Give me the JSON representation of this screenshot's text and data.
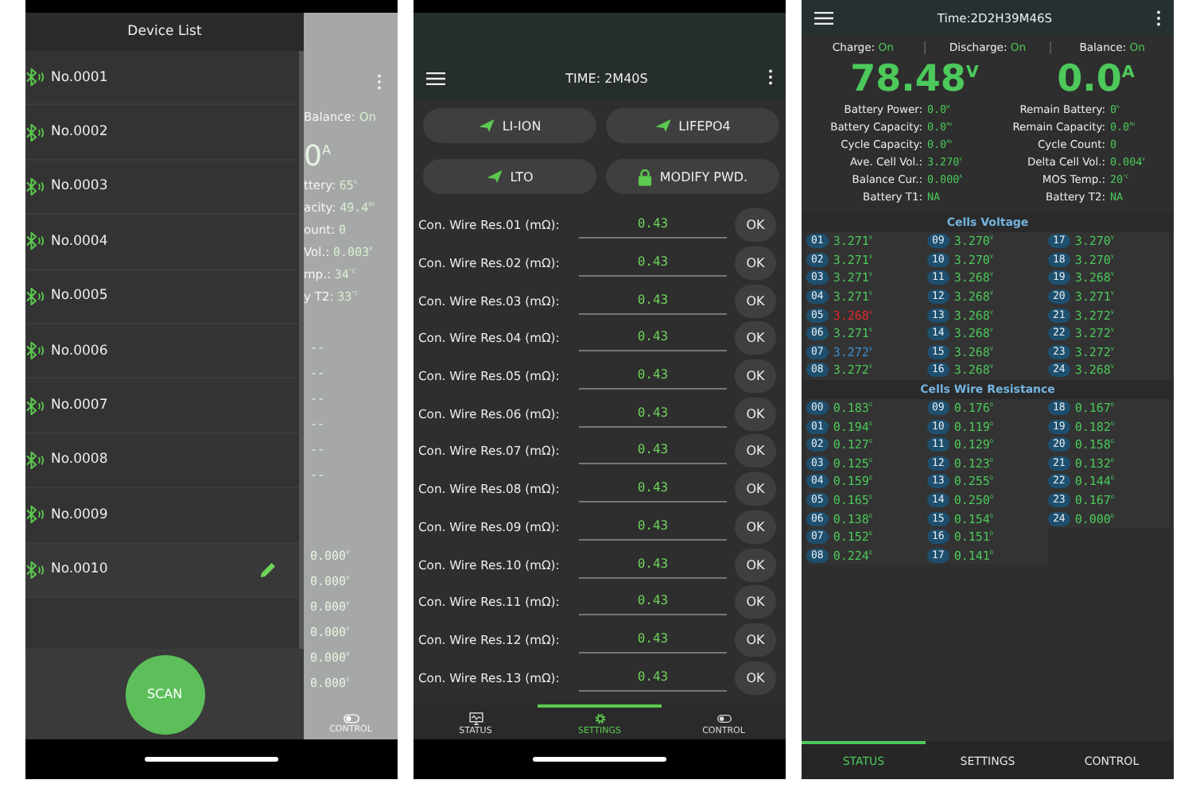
{
  "device_list_screen": {
    "title": "Device List",
    "devices": [
      {
        "name": "No.0001",
        "selected": false
      },
      {
        "name": "No.0002",
        "selected": false
      },
      {
        "name": "No.0003",
        "selected": false
      },
      {
        "name": "No.0004",
        "selected": false
      },
      {
        "name": "No.0005",
        "selected": false
      },
      {
        "name": "No.0006",
        "selected": false
      },
      {
        "name": "No.0007",
        "selected": false
      },
      {
        "name": "No.0008",
        "selected": false
      },
      {
        "name": "No.0009",
        "selected": false
      },
      {
        "name": "No.0010",
        "selected": true
      }
    ],
    "scan_button": "SCAN",
    "background_screen": {
      "balance_label": "Balance:",
      "balance_value": "On",
      "current": "0",
      "current_unit": "A",
      "stats": [
        {
          "label": "ttery:",
          "value": "65",
          "unit": "%"
        },
        {
          "label": "acity:",
          "value": "49.4",
          "unit": "Ah"
        },
        {
          "label": "ount:",
          "value": "0"
        },
        {
          "label": "Vol.:",
          "value": "0.003",
          "unit": "V"
        },
        {
          "label": "mp.:",
          "value": "34",
          "unit": "°C"
        },
        {
          "label": "y T2:",
          "value": "33",
          "unit": "°C"
        }
      ],
      "values": [
        {
          "value": "--"
        },
        {
          "value": "--"
        },
        {
          "value": "--"
        },
        {
          "value": "--"
        },
        {
          "value": "--"
        },
        {
          "value": "--"
        },
        {
          "value": "0.000",
          "unit": "V"
        },
        {
          "value": "0.000",
          "unit": "V"
        },
        {
          "value": "0.000",
          "unit": "V"
        },
        {
          "value": "0.000",
          "unit": "V"
        },
        {
          "value": "0.000",
          "unit": "V"
        },
        {
          "value": "0.000",
          "unit": "V"
        }
      ],
      "tab": {
        "label": "CONTROL"
      }
    }
  },
  "settings_screen": {
    "title": "TIME: 2M40S",
    "presets": [
      {
        "label": "LI-ION",
        "kind": "preset"
      },
      {
        "label": "LIFEPO4",
        "kind": "preset"
      },
      {
        "label": "LTO",
        "kind": "preset"
      },
      {
        "label": "MODIFY PWD.",
        "kind": "password"
      }
    ],
    "rows": [
      {
        "label": "Con. Wire Res.01 (mΩ):",
        "value": "0.43",
        "button": "OK"
      },
      {
        "label": "Con. Wire Res.02 (mΩ):",
        "value": "0.43",
        "button": "OK"
      },
      {
        "label": "Con. Wire Res.03 (mΩ):",
        "value": "0.43",
        "button": "OK"
      },
      {
        "label": "Con. Wire Res.04 (mΩ):",
        "value": "0.43",
        "button": "OK"
      },
      {
        "label": "Con. Wire Res.05 (mΩ):",
        "value": "0.43",
        "button": "OK"
      },
      {
        "label": "Con. Wire Res.06 (mΩ):",
        "value": "0.43",
        "button": "OK"
      },
      {
        "label": "Con. Wire Res.07 (mΩ):",
        "value": "0.43",
        "button": "OK"
      },
      {
        "label": "Con. Wire Res.08 (mΩ):",
        "value": "0.43",
        "button": "OK"
      },
      {
        "label": "Con. Wire Res.09 (mΩ):",
        "value": "0.43",
        "button": "OK"
      },
      {
        "label": "Con. Wire Res.10 (mΩ):",
        "value": "0.43",
        "button": "OK"
      },
      {
        "label": "Con. Wire Res.11 (mΩ):",
        "value": "0.43",
        "button": "OK"
      },
      {
        "label": "Con. Wire Res.12 (mΩ):",
        "value": "0.43",
        "button": "OK"
      },
      {
        "label": "Con. Wire Res.13 (mΩ):",
        "value": "0.43",
        "button": "OK"
      }
    ],
    "nav": [
      {
        "label": "STATUS",
        "selected": false
      },
      {
        "label": "SETTINGS",
        "selected": true
      },
      {
        "label": "CONTROL",
        "selected": false
      }
    ]
  },
  "status_screen": {
    "title": "Time:2D2H39M46S",
    "switches": [
      {
        "label": "Charge:",
        "value": "On"
      },
      {
        "label": "Discharge:",
        "value": "On"
      },
      {
        "label": "Balance:",
        "value": "On"
      }
    ],
    "voltage": {
      "value": "78.48",
      "unit": "V"
    },
    "current": {
      "value": "0.0",
      "unit": "A"
    },
    "stats_left": [
      {
        "label": "Battery Power:",
        "value": "0.0",
        "unit": "W"
      },
      {
        "label": "Battery Capacity:",
        "value": "0.0",
        "unit": "Ah"
      },
      {
        "label": "Cycle Capacity:",
        "value": "0.0",
        "unit": "Ah"
      },
      {
        "label": "Ave. Cell Vol.:",
        "value": "3.270",
        "unit": "V"
      },
      {
        "label": "Balance Cur.:",
        "value": "0.000",
        "unit": "A"
      },
      {
        "label": "Battery T1:",
        "value": "NA"
      }
    ],
    "stats_right": [
      {
        "label": "Remain Battery:",
        "value": "0",
        "unit": "%"
      },
      {
        "label": "Remain Capacity:",
        "value": "0.0",
        "unit": "Ah"
      },
      {
        "label": "Cycle Count:",
        "value": "0"
      },
      {
        "label": "Delta Cell Vol.:",
        "value": "0.004",
        "unit": "V"
      },
      {
        "label": "MOS Temp.:",
        "value": "20",
        "unit": "°C"
      },
      {
        "label": "Battery T2:",
        "value": "NA"
      }
    ],
    "cells_voltage": {
      "title": "Cells Voltage",
      "cells": [
        {
          "index": "01",
          "value": "3.271",
          "unit": "V",
          "color": "#4cc95a"
        },
        {
          "index": "02",
          "value": "3.271",
          "unit": "V",
          "color": "#4cc95a"
        },
        {
          "index": "03",
          "value": "3.271",
          "unit": "V",
          "color": "#4cc95a"
        },
        {
          "index": "04",
          "value": "3.271",
          "unit": "V",
          "color": "#4cc95a"
        },
        {
          "index": "05",
          "value": "3.268",
          "unit": "V",
          "color": "#e02828"
        },
        {
          "index": "06",
          "value": "3.271",
          "unit": "V",
          "color": "#4cc95a"
        },
        {
          "index": "07",
          "value": "3.272",
          "unit": "V",
          "color": "#3b8fd6"
        },
        {
          "index": "08",
          "value": "3.272",
          "unit": "V",
          "color": "#4cc95a"
        },
        {
          "index": "09",
          "value": "3.270",
          "unit": "V",
          "color": "#4cc95a"
        },
        {
          "index": "10",
          "value": "3.270",
          "unit": "V",
          "color": "#4cc95a"
        },
        {
          "index": "11",
          "value": "3.268",
          "unit": "V",
          "color": "#4cc95a"
        },
        {
          "index": "12",
          "value": "3.268",
          "unit": "V",
          "color": "#4cc95a"
        },
        {
          "index": "13",
          "value": "3.268",
          "unit": "V",
          "color": "#4cc95a"
        },
        {
          "index": "14",
          "value": "3.268",
          "unit": "V",
          "color": "#4cc95a"
        },
        {
          "index": "15",
          "value": "3.268",
          "unit": "V",
          "color": "#4cc95a"
        },
        {
          "index": "16",
          "value": "3.268",
          "unit": "V",
          "color": "#4cc95a"
        },
        {
          "index": "17",
          "value": "3.270",
          "unit": "V",
          "color": "#4cc95a"
        },
        {
          "index": "18",
          "value": "3.270",
          "unit": "V",
          "color": "#4cc95a"
        },
        {
          "index": "19",
          "value": "3.268",
          "unit": "V",
          "color": "#4cc95a"
        },
        {
          "index": "20",
          "value": "3.271",
          "unit": "V",
          "color": "#4cc95a"
        },
        {
          "index": "21",
          "value": "3.272",
          "unit": "V",
          "color": "#4cc95a"
        },
        {
          "index": "22",
          "value": "3.272",
          "unit": "V",
          "color": "#4cc95a"
        },
        {
          "index": "23",
          "value": "3.272",
          "unit": "V",
          "color": "#4cc95a"
        },
        {
          "index": "24",
          "value": "3.268",
          "unit": "V",
          "color": "#4cc95a"
        }
      ]
    },
    "cells_wire_resistance": {
      "title": "Cells Wire Resistance",
      "cells": [
        {
          "index": "00",
          "value": "0.183",
          "unit": "Ω"
        },
        {
          "index": "01",
          "value": "0.194",
          "unit": "Ω"
        },
        {
          "index": "02",
          "value": "0.127",
          "unit": "Ω"
        },
        {
          "index": "03",
          "value": "0.125",
          "unit": "Ω"
        },
        {
          "index": "04",
          "value": "0.159",
          "unit": "Ω"
        },
        {
          "index": "05",
          "value": "0.165",
          "unit": "Ω"
        },
        {
          "index": "06",
          "value": "0.138",
          "unit": "Ω"
        },
        {
          "index": "07",
          "value": "0.152",
          "unit": "Ω"
        },
        {
          "index": "08",
          "value": "0.224",
          "unit": "Ω"
        },
        {
          "index": "09",
          "value": "0.176",
          "unit": "Ω"
        },
        {
          "index": "10",
          "value": "0.119",
          "unit": "Ω"
        },
        {
          "index": "11",
          "value": "0.129",
          "unit": "Ω"
        },
        {
          "index": "12",
          "value": "0.123",
          "unit": "Ω"
        },
        {
          "index": "13",
          "value": "0.255",
          "unit": "Ω"
        },
        {
          "index": "14",
          "value": "0.250",
          "unit": "Ω"
        },
        {
          "index": "15",
          "value": "0.154",
          "unit": "Ω"
        },
        {
          "index": "16",
          "value": "0.151",
          "unit": "Ω"
        },
        {
          "index": "17",
          "value": "0.141",
          "unit": "Ω"
        },
        {
          "index": "18",
          "value": "0.167",
          "unit": "Ω"
        },
        {
          "index": "19",
          "value": "0.182",
          "unit": "Ω"
        },
        {
          "index": "20",
          "value": "0.158",
          "unit": "Ω"
        },
        {
          "index": "21",
          "value": "0.132",
          "unit": "Ω"
        },
        {
          "index": "22",
          "value": "0.144",
          "unit": "Ω"
        },
        {
          "index": "23",
          "value": "0.167",
          "unit": "Ω"
        },
        {
          "index": "24",
          "value": "0.000",
          "unit": "Ω"
        }
      ]
    },
    "tabs": [
      {
        "label": "STATUS",
        "selected": true
      },
      {
        "label": "SETTINGS",
        "selected": false
      },
      {
        "label": "CONTROL",
        "selected": false
      }
    ]
  }
}
